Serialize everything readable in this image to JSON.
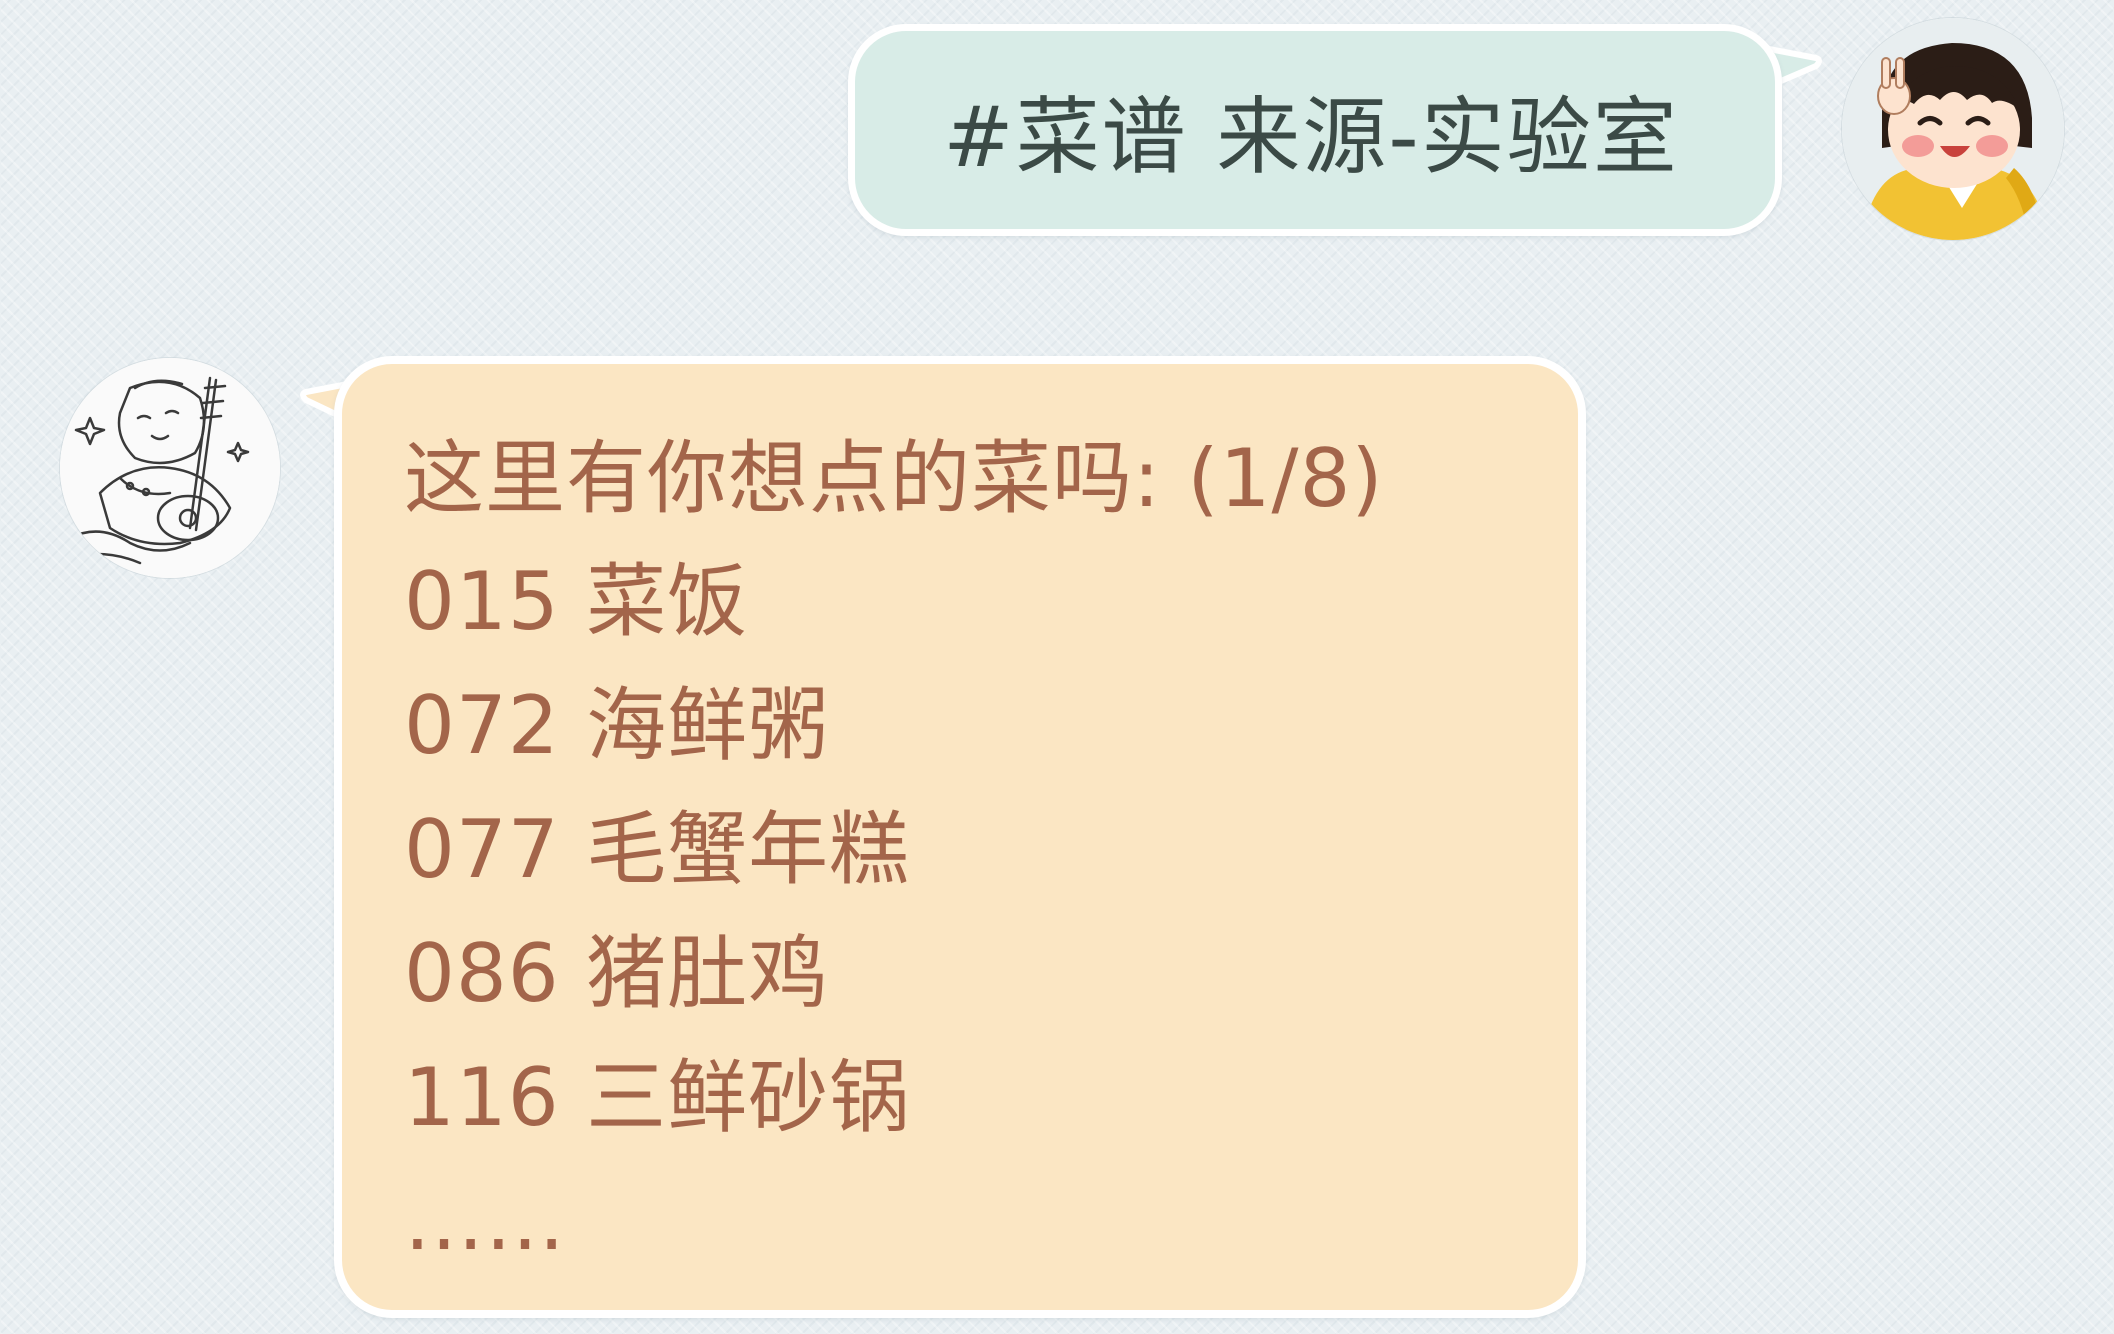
{
  "outgoing_message": {
    "text": "#菜谱 来源-实验室"
  },
  "incoming_message": {
    "header": "这里有你想点的菜吗: (1/8)",
    "items": [
      "015 菜饭",
      "072 海鲜粥",
      "077 毛蟹年糕",
      "086 猪肚鸡",
      "116 三鲜砂锅"
    ],
    "ellipsis": "……"
  },
  "avatars": {
    "user": "cartoon-girl-avatar",
    "bot": "sketch-musician-avatar"
  },
  "colors": {
    "background": "#e9eff2",
    "outgoing_bubble": "#d8ece7",
    "outgoing_text": "#3b4a46",
    "incoming_bubble": "#fbe6c3",
    "incoming_text": "#a3654a"
  }
}
